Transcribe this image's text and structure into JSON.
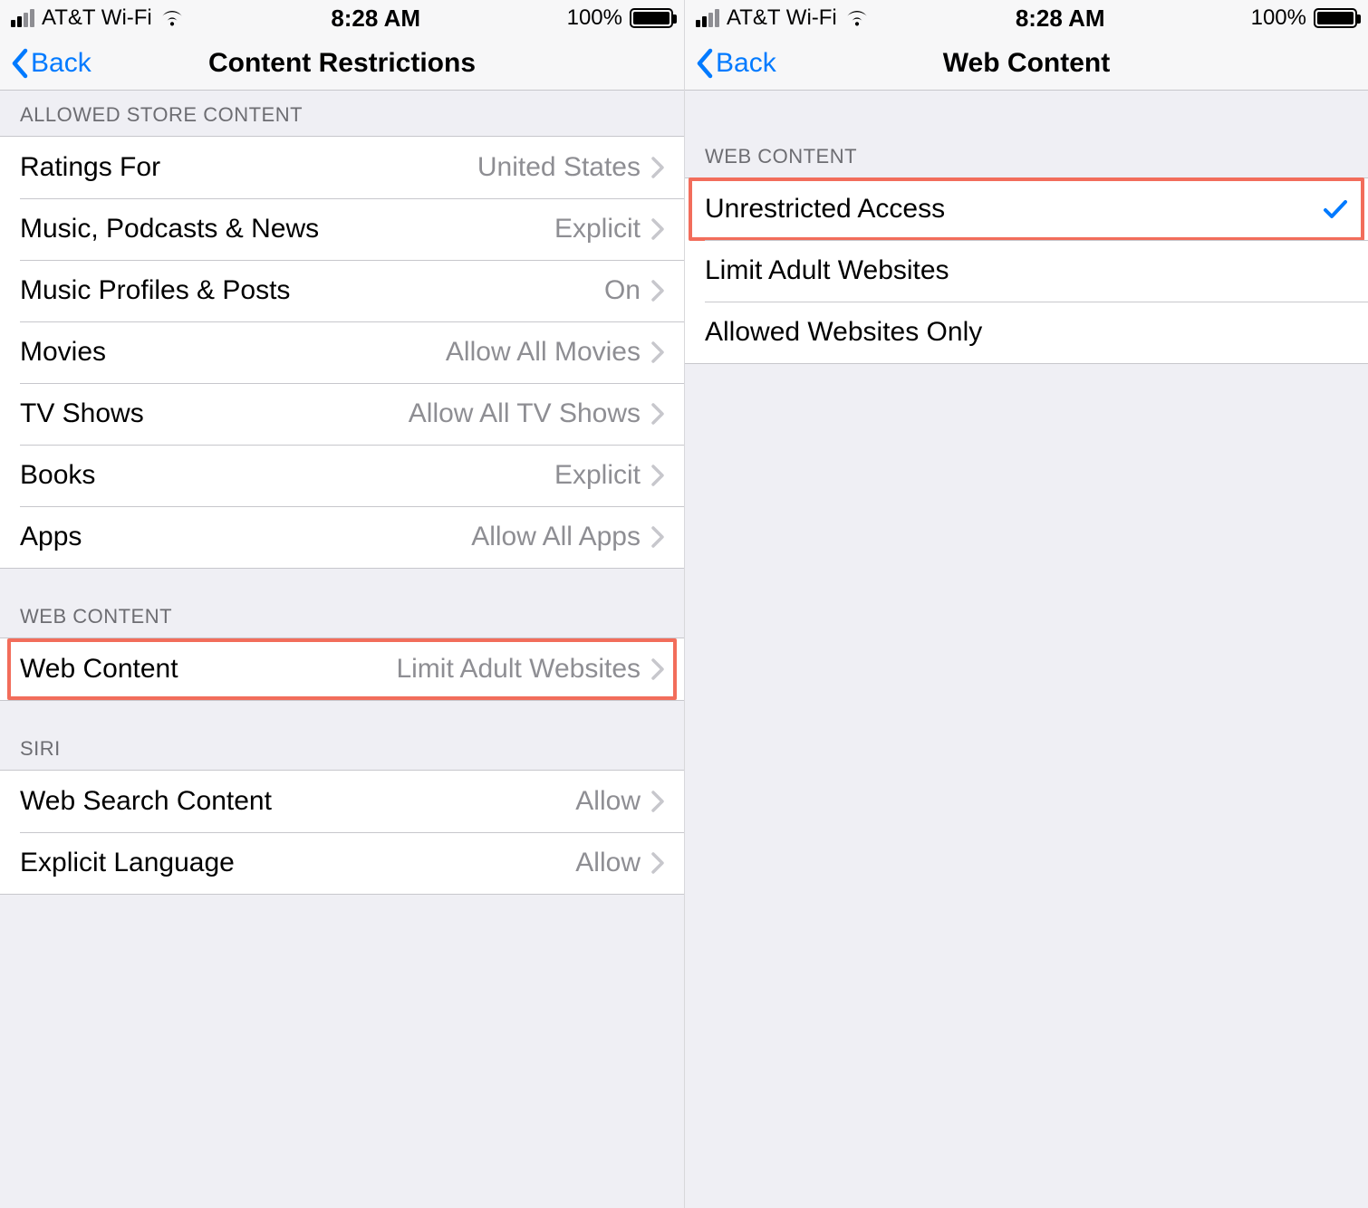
{
  "left": {
    "status": {
      "carrier": "AT&T Wi-Fi",
      "time": "8:28 AM",
      "battery": "100%"
    },
    "nav": {
      "back": "Back",
      "title": "Content Restrictions"
    },
    "sections": {
      "store": {
        "header": "ALLOWED STORE CONTENT",
        "rows": [
          {
            "label": "Ratings For",
            "value": "United States"
          },
          {
            "label": "Music, Podcasts & News",
            "value": "Explicit"
          },
          {
            "label": "Music Profiles & Posts",
            "value": "On"
          },
          {
            "label": "Movies",
            "value": "Allow All Movies"
          },
          {
            "label": "TV Shows",
            "value": "Allow All TV Shows"
          },
          {
            "label": "Books",
            "value": "Explicit"
          },
          {
            "label": "Apps",
            "value": "Allow All Apps"
          }
        ]
      },
      "web": {
        "header": "WEB CONTENT",
        "rows": [
          {
            "label": "Web Content",
            "value": "Limit Adult Websites",
            "highlighted": true
          }
        ]
      },
      "siri": {
        "header": "SIRI",
        "rows": [
          {
            "label": "Web Search Content",
            "value": "Allow"
          },
          {
            "label": "Explicit Language",
            "value": "Allow"
          }
        ]
      }
    }
  },
  "right": {
    "status": {
      "carrier": "AT&T Wi-Fi",
      "time": "8:28 AM",
      "battery": "100%"
    },
    "nav": {
      "back": "Back",
      "title": "Web Content"
    },
    "section": {
      "header": "WEB CONTENT",
      "options": [
        {
          "label": "Unrestricted Access",
          "selected": true,
          "highlighted": true
        },
        {
          "label": "Limit Adult Websites",
          "selected": false,
          "highlighted": false
        },
        {
          "label": "Allowed Websites Only",
          "selected": false,
          "highlighted": false
        }
      ]
    }
  },
  "colors": {
    "accent": "#007aff",
    "highlight": "#f26d5b"
  }
}
